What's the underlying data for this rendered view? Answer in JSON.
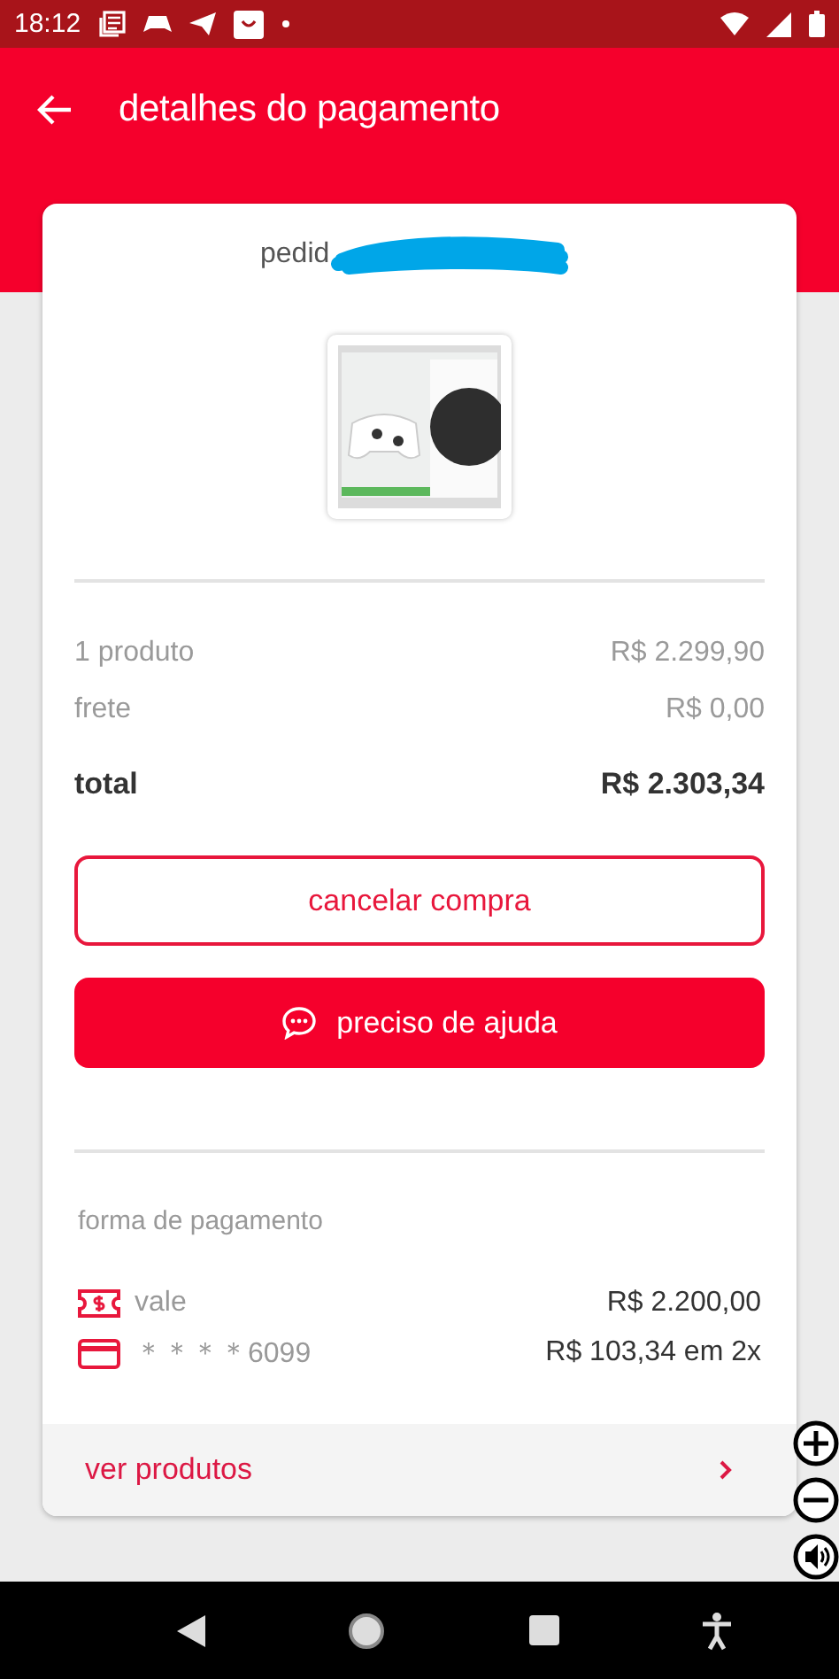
{
  "status_bar": {
    "time": "18:12"
  },
  "header": {
    "title": "detalhes do pagamento"
  },
  "order": {
    "label": "pedid"
  },
  "summary": [
    {
      "label": "1 produto",
      "value": "R$ 2.299,90",
      "kind": "line"
    },
    {
      "label": "frete",
      "value": "R$ 0,00",
      "kind": "line"
    },
    {
      "label": "total",
      "value": "R$ 2.303,34",
      "kind": "total"
    }
  ],
  "buttons": [
    {
      "label": "cancelar compra",
      "kind": "outline"
    },
    {
      "label": "preciso de ajuda",
      "kind": "filled"
    }
  ],
  "payment": {
    "title": "forma de pagamento",
    "methods": [
      {
        "kind": "voucher",
        "label": "vale",
        "amount": "R$ 2.200,00"
      },
      {
        "kind": "card",
        "label": "＊＊＊＊6099",
        "amount": "R$ 103,34 em 2x"
      }
    ]
  },
  "footer_link": {
    "label": "ver produtos"
  }
}
